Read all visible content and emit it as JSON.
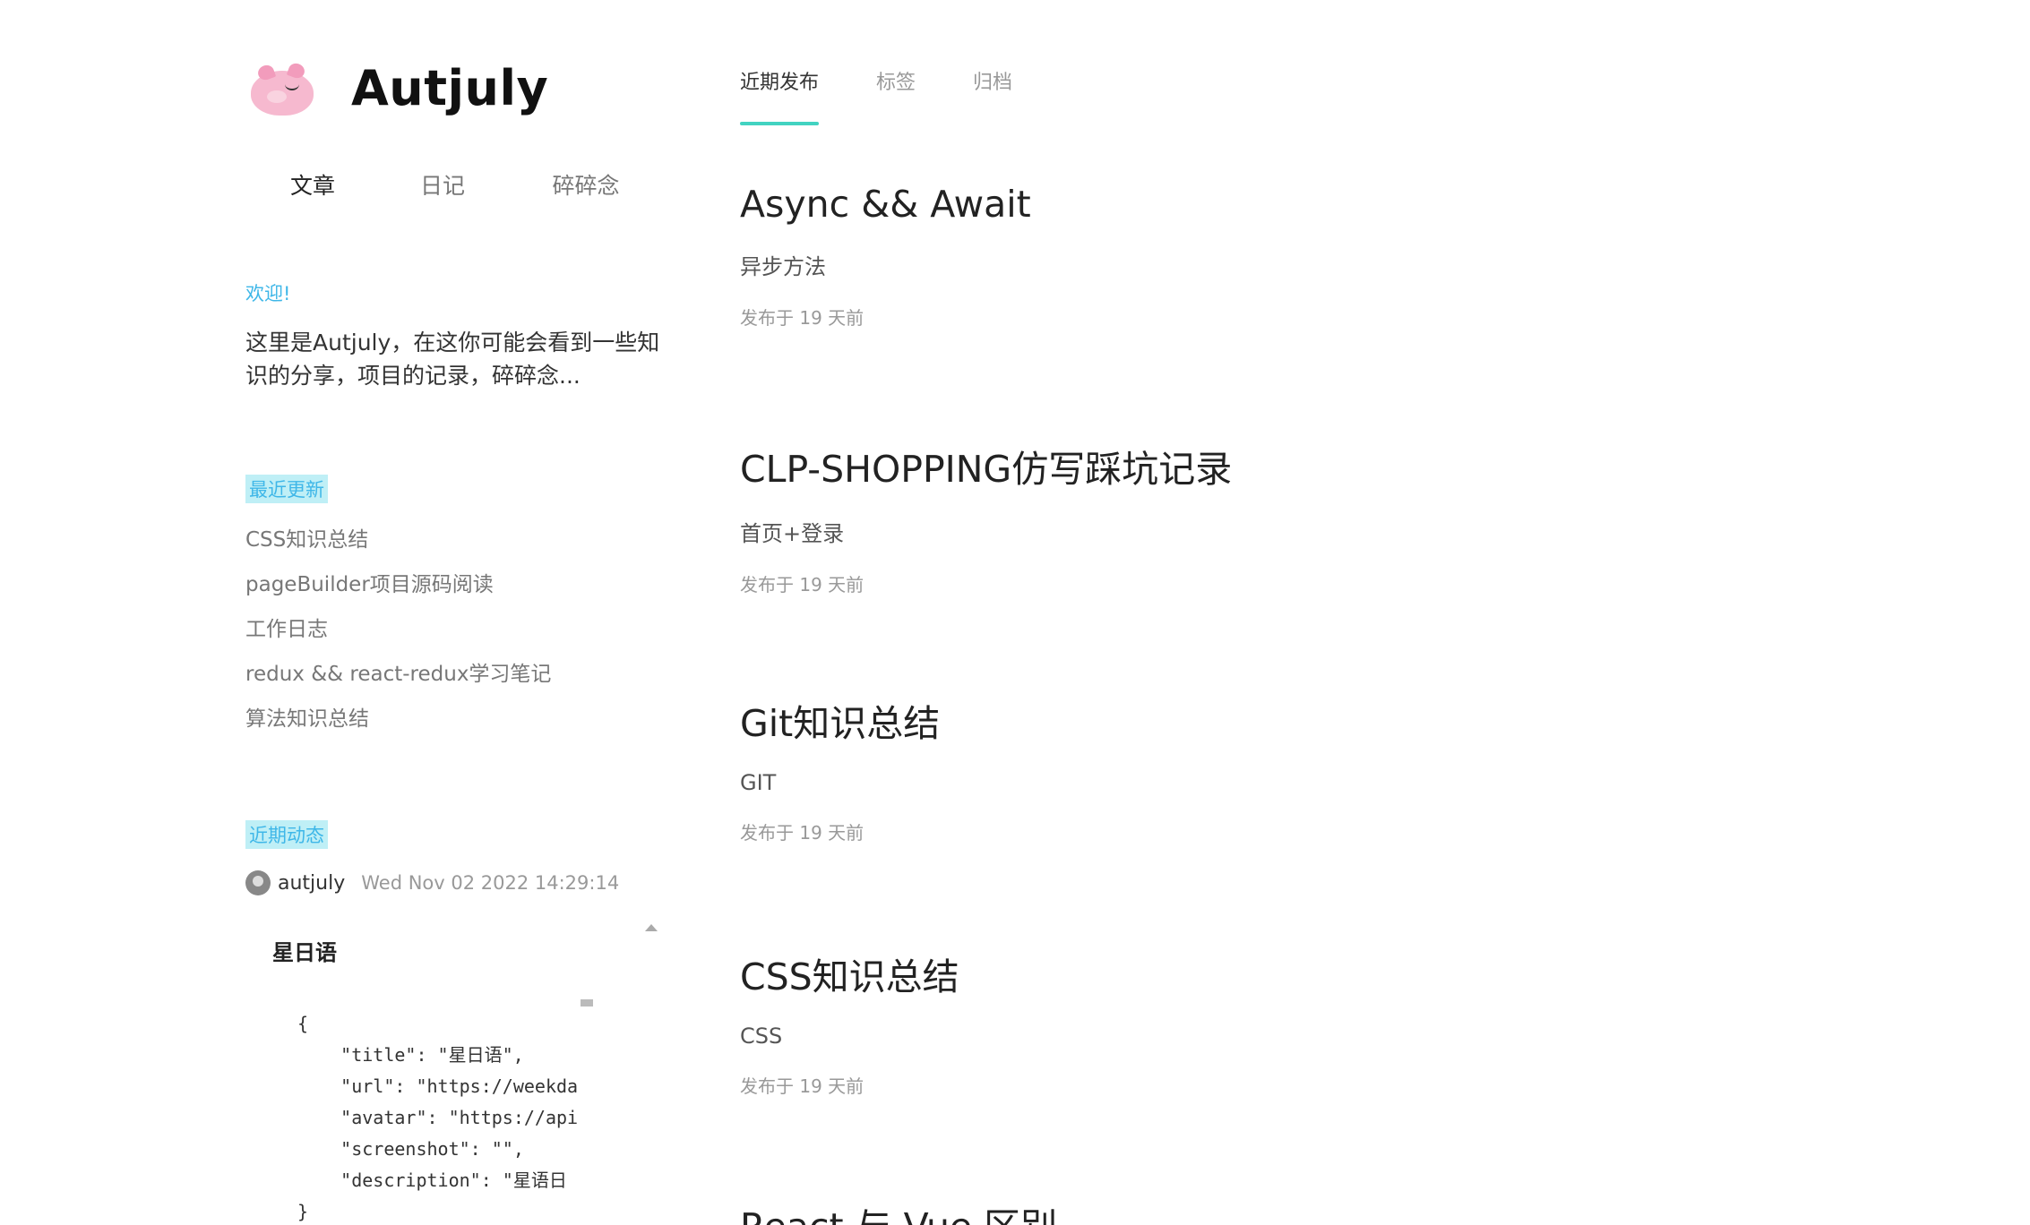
{
  "brand": {
    "title": "Autjuly"
  },
  "sub_nav": {
    "items": [
      {
        "label": "文章"
      },
      {
        "label": "日记"
      },
      {
        "label": "碎碎念"
      }
    ]
  },
  "welcome": {
    "label": "欢迎!",
    "description": "这里是Autjuly，在这你可能会看到一些知识的分享，项目的记录，碎碎念..."
  },
  "recent": {
    "label": "最近更新",
    "items": [
      {
        "label": "CSS知识总结"
      },
      {
        "label": "pageBuilder项目源码阅读"
      },
      {
        "label": "工作日志"
      },
      {
        "label": "redux && react-redux学习笔记"
      },
      {
        "label": "算法知识总结"
      }
    ]
  },
  "activity": {
    "label": "近期动态",
    "user": "autjuly",
    "date": "Wed Nov 02 2022 14:29:14",
    "repo_name": "星日语",
    "code": "{\n    \"title\": \"星日语\",\n    \"url\": \"https://weekda\n    \"avatar\": \"https://api\n    \"screenshot\": \"\",\n    \"description\": \"星语日\n}"
  },
  "tabs": [
    {
      "label": "近期发布"
    },
    {
      "label": "标签"
    },
    {
      "label": "归档"
    }
  ],
  "posts": [
    {
      "title": "Async && Await",
      "subtitle": "异步方法",
      "time": "发布于 19 天前"
    },
    {
      "title": "CLP-SHOPPING仿写踩坑记录",
      "subtitle": "首页+登录",
      "time": "发布于 19 天前"
    },
    {
      "title": "Git知识总结",
      "subtitle": "GIT",
      "time": "发布于 19 天前"
    },
    {
      "title": "CSS知识总结",
      "subtitle": "CSS",
      "time": "发布于 19 天前"
    },
    {
      "title": "React 与 Vue 区别",
      "subtitle": "",
      "time": ""
    }
  ],
  "colors": {
    "accent": "#42d3c1",
    "label_blue": "#3fb7e8",
    "highlight": "#bfeff6",
    "logo_pink": "#f6b9cf"
  }
}
